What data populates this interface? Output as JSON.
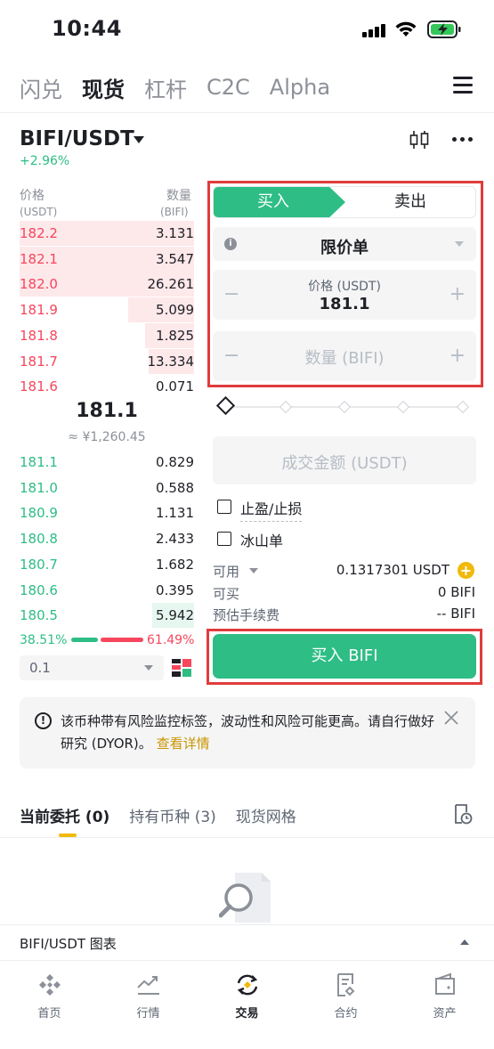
{
  "status": {
    "time": "10:44"
  },
  "nav": {
    "tabs": [
      "闪兑",
      "现货",
      "杠杆",
      "C2C",
      "Alpha"
    ],
    "active": 1
  },
  "pair": {
    "symbol": "BIFI/USDT",
    "change": "+2.96%"
  },
  "orderbook": {
    "head_price": "价格",
    "head_price_unit": "(USDT)",
    "head_qty": "数量",
    "head_qty_unit": "(BIFI)",
    "asks": [
      {
        "price": "182.2",
        "qty": "3.131",
        "depth": 1.0
      },
      {
        "price": "182.1",
        "qty": "3.547",
        "depth": 1.0
      },
      {
        "price": "182.0",
        "qty": "26.261",
        "depth": 1.0
      },
      {
        "price": "181.9",
        "qty": "5.099",
        "depth": 0.38
      },
      {
        "price": "181.8",
        "qty": "1.825",
        "depth": 0.28
      },
      {
        "price": "181.7",
        "qty": "13.334",
        "depth": 0.26
      },
      {
        "price": "181.6",
        "qty": "0.071",
        "depth": 0.0
      }
    ],
    "mid_price": "181.1",
    "mid_fiat": "≈ ¥1,260.45",
    "bids": [
      {
        "price": "181.1",
        "qty": "0.829",
        "depth": 0.0
      },
      {
        "price": "181.0",
        "qty": "0.588",
        "depth": 0.0
      },
      {
        "price": "180.9",
        "qty": "1.131",
        "depth": 0.0
      },
      {
        "price": "180.8",
        "qty": "2.433",
        "depth": 0.0
      },
      {
        "price": "180.7",
        "qty": "1.682",
        "depth": 0.0
      },
      {
        "price": "180.6",
        "qty": "0.395",
        "depth": 0.0
      },
      {
        "price": "180.5",
        "qty": "5.942",
        "depth": 0.24
      }
    ],
    "buy_ratio": "38.51%",
    "sell_ratio": "61.49%",
    "depth_value": "0.1"
  },
  "form": {
    "buy_tab": "买入",
    "sell_tab": "卖出",
    "order_type": "限价单",
    "price_label": "价格 (USDT)",
    "price_value": "181.1",
    "qty_placeholder": "数量 (BIFI)",
    "minus": "−",
    "plus": "+",
    "amount_placeholder": "成交金额 (USDT)",
    "tpsl_label": "止盈/止损",
    "iceberg_label": "冰山单",
    "available_label": "可用",
    "available_value": "0.1317301 USDT",
    "can_buy_label": "可买",
    "can_buy_value": "0 BIFI",
    "fee_label": "预估手续费",
    "fee_value": "-- BIFI",
    "submit": "买入 BIFI"
  },
  "banner": {
    "text": "该币种带有风险监控标签，波动性和风险可能更高。请自行做好研究 (DYOR)。",
    "link": "查看详情"
  },
  "orders": {
    "tabs": [
      "当前委托 (0)",
      "持有币种 (3)",
      "现货网格"
    ]
  },
  "chart_bar": {
    "label": "BIFI/USDT 图表"
  },
  "bottom": {
    "tabs": [
      "首页",
      "行情",
      "交易",
      "合约",
      "资产"
    ],
    "active": 2
  },
  "colors": {
    "buy": "#2ebd85",
    "sell": "#f6465d",
    "accent": "#f0b90b",
    "highlight": "#e03c3c"
  }
}
